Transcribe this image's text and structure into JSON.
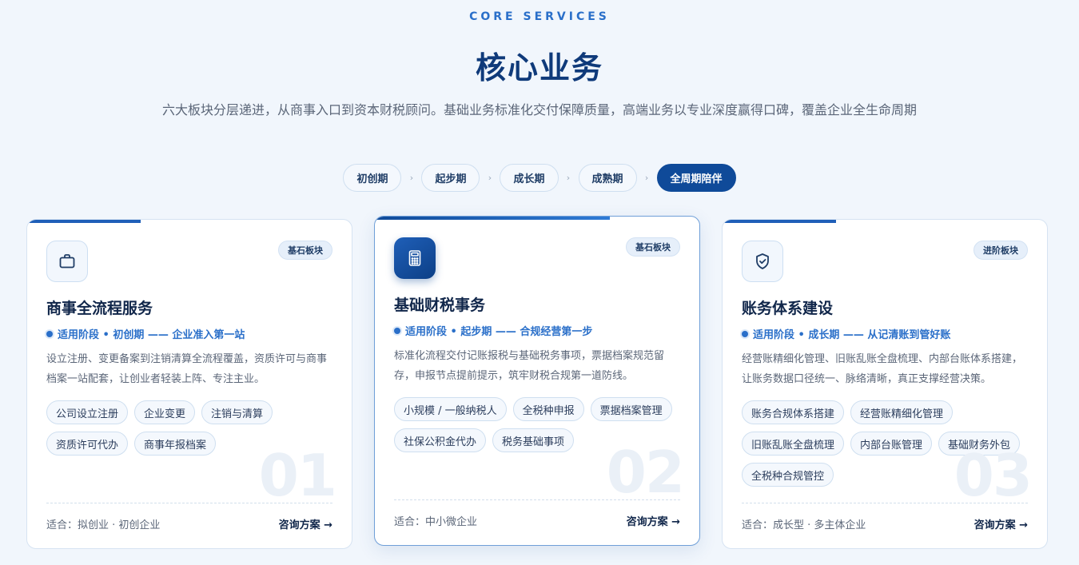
{
  "header": {
    "eyebrow": "CORE SERVICES",
    "title": "核心业务",
    "subtitle": "六大板块分层递进，从商事入口到资本财税顾问。基础业务标准化交付保障质量，高端业务以专业深度赢得口碑，覆盖企业全生命周期"
  },
  "stages": [
    {
      "label": "初创期",
      "active": false
    },
    {
      "label": "起步期",
      "active": false
    },
    {
      "label": "成长期",
      "active": false
    },
    {
      "label": "成熟期",
      "active": false
    },
    {
      "label": "全周期陪伴",
      "active": true
    }
  ],
  "stage_separator": "›",
  "colors": {
    "accent": "#2a6fc9",
    "brand_dark": "#0f4a99",
    "title": "#0f3a7a",
    "background": "#f1f6fc"
  },
  "cards": [
    {
      "icon": "briefcase-icon",
      "badge": "基石板块",
      "title": "商事全流程服务",
      "stage_line": "适用阶段 • 初创期 —— 企业准入第一站",
      "desc": "设立注册、变更备案到注销清算全流程覆盖，资质许可与商事档案一站配套，让创业者轻装上阵、专注主业。",
      "tags": [
        "公司设立注册",
        "企业变更",
        "注销与清算",
        "资质许可代办",
        "商事年报档案"
      ],
      "number": "01",
      "fit": "适合：拟创业 · 初创企业",
      "consult": "咨询方案 →"
    },
    {
      "icon": "calculator-icon",
      "badge": "基石板块",
      "title": "基础财税事务",
      "stage_line": "适用阶段 • 起步期 —— 合规经营第一步",
      "desc": "标准化流程交付记账报税与基础税务事项，票据档案规范留存，申报节点提前提示，筑牢财税合规第一道防线。",
      "tags": [
        "小规模 / 一般纳税人",
        "全税种申报",
        "票据档案管理",
        "社保公积金代办",
        "税务基础事项"
      ],
      "number": "02",
      "fit": "适合：中小微企业",
      "consult": "咨询方案 →"
    },
    {
      "icon": "shield-check-icon",
      "badge": "进阶板块",
      "title": "账务体系建设",
      "stage_line": "适用阶段 • 成长期 —— 从记清账到管好账",
      "desc": "经营账精细化管理、旧账乱账全盘梳理、内部台账体系搭建，让账务数据口径统一、脉络清晰，真正支撑经营决策。",
      "tags": [
        "账务合规体系搭建",
        "经营账精细化管理",
        "旧账乱账全盘梳理",
        "内部台账管理",
        "基础财务外包",
        "全税种合规管控"
      ],
      "number": "03",
      "fit": "适合：成长型 · 多主体企业",
      "consult": "咨询方案 →"
    }
  ]
}
